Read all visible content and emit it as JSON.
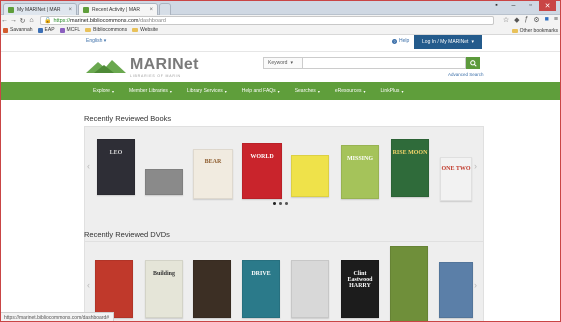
{
  "browser": {
    "tabs": [
      {
        "label": "My MARINet | MAR",
        "active": false
      },
      {
        "label": "Recent Activity | MAR",
        "active": true
      }
    ],
    "address": {
      "host": "marinet.bibliocommons.com",
      "path": "/dashboard",
      "scheme_label": "https://"
    },
    "bookmarks": [
      {
        "label": "Savannah",
        "color": "#d25c2f"
      },
      {
        "label": "EAP",
        "color": "#3b6fb6"
      },
      {
        "label": "MCFL",
        "color": "#8b5fbf"
      },
      {
        "label": "Bibliocommons",
        "folder": true
      },
      {
        "label": "Website",
        "folder": true
      }
    ],
    "other_bookmarks": "Other bookmarks",
    "status_url": "https://marinet.bibliocommons.com/dashboard#"
  },
  "site": {
    "language": "English",
    "help": "Help",
    "login": "Log In / My MARINet",
    "logo_name": "MARINet",
    "logo_tagline": "LIBRARIES OF MARIN",
    "search_type": "Keyword",
    "search_value": "",
    "advanced_search": "Advanced Search",
    "nav": [
      "Explore",
      "Member Libraries",
      "Library Services",
      "Help and FAQs",
      "Searches",
      "eResources",
      "LinkPlus"
    ],
    "colors": {
      "nav_green": "#5f9e3b",
      "login_blue": "#245b8c",
      "link_blue": "#3a6ea8"
    }
  },
  "sections": {
    "books": {
      "title": "Recently Reviewed Books",
      "covers": [
        {
          "title": "LEO",
          "bg": "#2e2e36",
          "fg": "#d9d9d9"
        },
        {
          "title": "",
          "bg": "#8a8a8a",
          "fg": "#ffffff"
        },
        {
          "title": "BEAR",
          "bg": "#f1ebe0",
          "fg": "#8c5a2b"
        },
        {
          "title": "WORLD",
          "bg": "#c9242c",
          "fg": "#ffffff"
        },
        {
          "title": "",
          "bg": "#efe24a",
          "fg": "#333333"
        },
        {
          "title": "MISSING",
          "bg": "#a5c35a",
          "fg": "#ffffff"
        },
        {
          "title": "RISE MOON",
          "bg": "#2f6b3a",
          "fg": "#f5d66b"
        },
        {
          "title": "ONE TWO",
          "bg": "#f2f2f2",
          "fg": "#c0392b"
        }
      ]
    },
    "dvds": {
      "title": "Recently Reviewed DVDs",
      "covers": [
        {
          "title": "",
          "bg": "#c0392b",
          "fg": "#ffffff"
        },
        {
          "title": "Building",
          "bg": "#e5e5d8",
          "fg": "#333333"
        },
        {
          "title": "",
          "bg": "#3c2f24",
          "fg": "#ffffff"
        },
        {
          "title": "DRIVE",
          "bg": "#2b7a8a",
          "fg": "#ffffff"
        },
        {
          "title": "",
          "bg": "#d8d8d8",
          "fg": "#333333"
        },
        {
          "title": "Clint Eastwood HARRY",
          "bg": "#1c1c1c",
          "fg": "#ffffff"
        },
        {
          "title": "",
          "bg": "#6f8f3a",
          "fg": "#f3d34a"
        },
        {
          "title": "",
          "bg": "#5b7fa8",
          "fg": "#ffffff"
        }
      ]
    }
  }
}
